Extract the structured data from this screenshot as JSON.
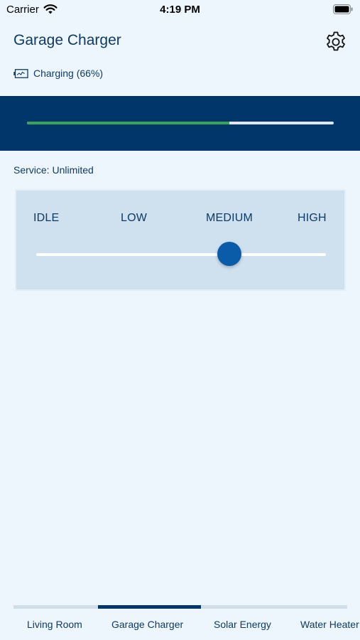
{
  "status_bar": {
    "carrier": "Carrier",
    "time": "4:19 PM"
  },
  "header": {
    "title": "Garage Charger",
    "settings_icon": "gear-icon"
  },
  "charging": {
    "icon": "battery-charging-icon",
    "text": "Charging (66%)",
    "progress": 0.66
  },
  "service": {
    "text": "Service: Unlimited"
  },
  "level": {
    "options": [
      "IDLE",
      "LOW",
      "MEDIUM",
      "HIGH"
    ],
    "selected": "MEDIUM",
    "selected_index": 2
  },
  "tabs": {
    "items": [
      {
        "label": "Living Room"
      },
      {
        "label": "Garage Charger"
      },
      {
        "label": "Solar Energy"
      },
      {
        "label": "Water Heater"
      }
    ],
    "active_index": 1
  },
  "colors": {
    "background": "#eef6fd",
    "primary": "#003669",
    "accent": "#0a5ba8",
    "progress": "#3aa35a",
    "panel": "#cfe0ee"
  }
}
